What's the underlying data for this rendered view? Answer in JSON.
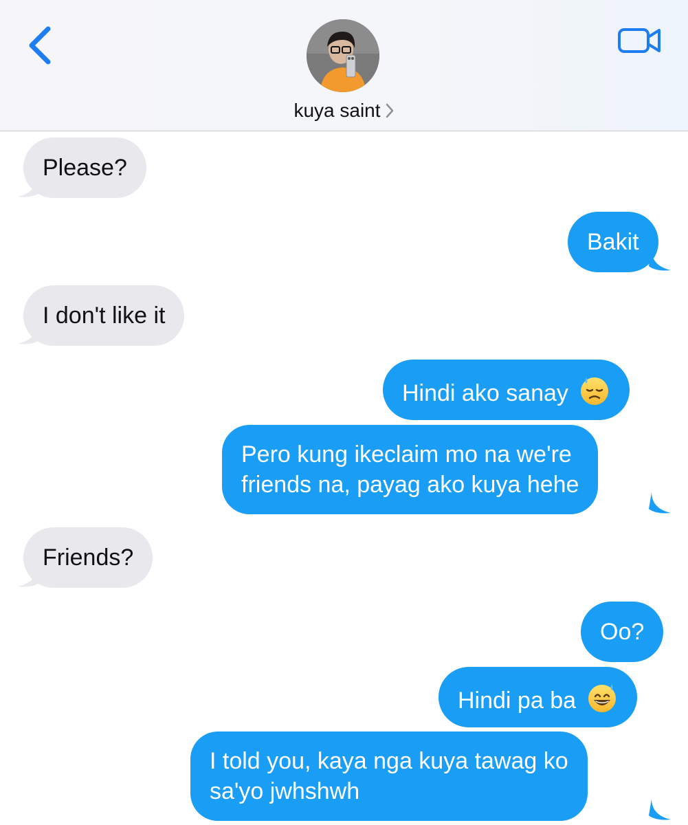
{
  "header": {
    "contact_name": "kuya saint"
  },
  "icons": {
    "back": "chevron-left-icon",
    "video": "video-camera-icon",
    "contact_disclosure": "chevron-right-icon",
    "emoji_sweat": "downcast-face-with-sweat-emoji",
    "emoji_grin_sweat": "grinning-face-with-sweat-emoji"
  },
  "colors": {
    "accent": "#1a9df4",
    "incoming_bubble": "#e8e8ed",
    "ios_blue": "#1e7df1"
  },
  "messages": [
    {
      "sender": "contact",
      "text": "Please?"
    },
    {
      "sender": "me",
      "text": "Bakit"
    },
    {
      "sender": "contact",
      "text": "I don't like it"
    },
    {
      "sender": "me",
      "text": "Hindi ako sanay",
      "emoji": "😓"
    },
    {
      "sender": "me",
      "lines": [
        "Pero kung ikeclaim mo na we're",
        "friends na, payag ako kuya hehe"
      ]
    },
    {
      "sender": "contact",
      "text": "Friends?"
    },
    {
      "sender": "me",
      "text": "Oo?"
    },
    {
      "sender": "me",
      "text": "Hindi pa ba",
      "emoji": "😅"
    },
    {
      "sender": "me",
      "lines": [
        "I told you, kaya nga kuya tawag ko",
        "sa'yo jwhshwh"
      ]
    }
  ]
}
